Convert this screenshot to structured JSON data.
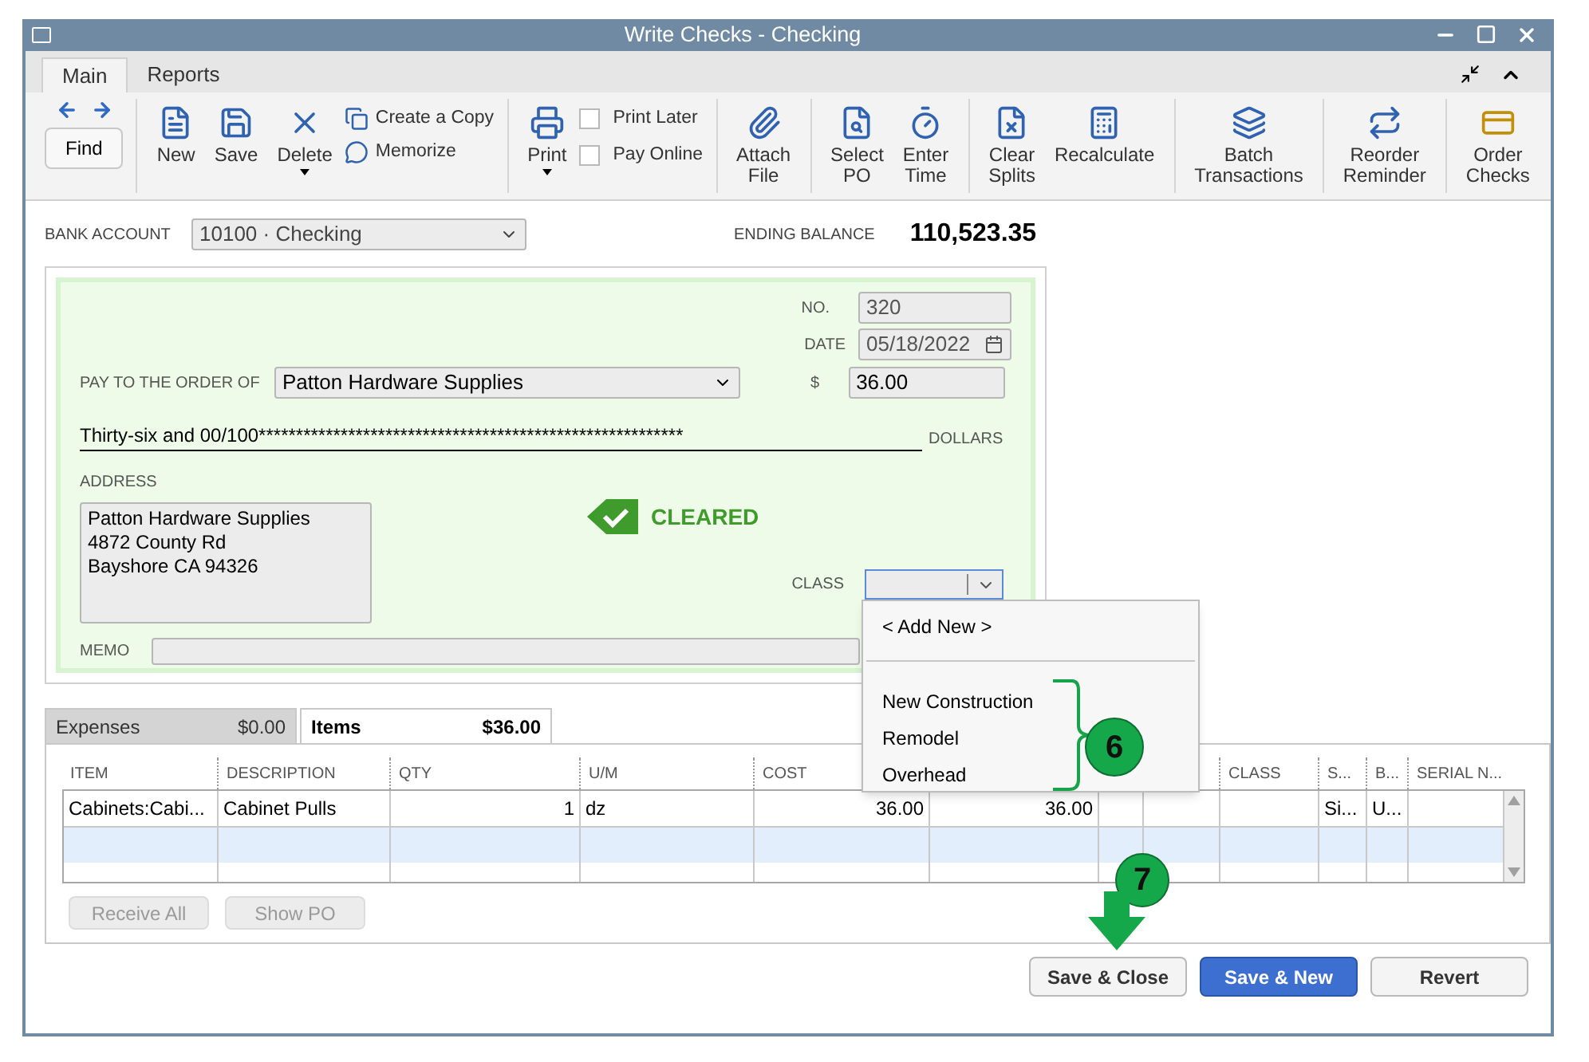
{
  "window": {
    "title": "Write Checks - Checking"
  },
  "ribbon_tabs": [
    {
      "label": "Main",
      "selected": true
    },
    {
      "label": "Reports",
      "selected": false
    }
  ],
  "toolbar": [
    [
      {
        "kind": "nav",
        "label": "Find"
      }
    ],
    [
      {
        "kind": "large",
        "label": "New",
        "has_menu": false
      },
      {
        "kind": "large",
        "label": "Save",
        "has_menu": false
      },
      {
        "kind": "large",
        "label": "Delete",
        "has_menu": true
      },
      {
        "kind": "small",
        "labels": [
          "Create a Copy",
          "Memorize"
        ]
      }
    ],
    [
      {
        "kind": "large",
        "label": "Print",
        "has_menu": true
      },
      {
        "kind": "check",
        "options": [
          {
            "label": "Print Later",
            "checked": false
          },
          {
            "label": "Pay Online",
            "checked": false
          }
        ]
      }
    ],
    [
      {
        "kind": "large",
        "label": "Attach File",
        "has_menu": false
      }
    ],
    [
      {
        "kind": "large",
        "label": "Select PO",
        "has_menu": false
      },
      {
        "kind": "large",
        "label": "Enter Time",
        "has_menu": false
      }
    ],
    [
      {
        "kind": "large",
        "label": "Clear Splits",
        "has_menu": false
      },
      {
        "kind": "large",
        "label": "Recalculate",
        "has_menu": false
      }
    ],
    [
      {
        "kind": "large",
        "label": "Batch Transactions",
        "has_menu": false
      }
    ],
    [
      {
        "kind": "large",
        "label": "Reorder Reminder",
        "has_menu": false
      }
    ],
    [
      {
        "kind": "large",
        "label": "Order Checks",
        "has_menu": false
      }
    ]
  ],
  "bank_account": {
    "label": "BANK ACCOUNT",
    "value": "10100 · Checking"
  },
  "ending_balance": {
    "label": "ENDING BALANCE",
    "value": "110,523.35"
  },
  "check": {
    "no_label": "NO.",
    "no": "320",
    "date_label": "DATE",
    "date": "05/18/2022",
    "payee_label": "PAY TO THE ORDER OF",
    "payee": "Patton Hardware Supplies",
    "amount_label": "$",
    "amount": "36.00",
    "amount_words": "Thirty-six and 00/100*********************************************************",
    "dollars_label": "DOLLARS",
    "address_label": "ADDRESS",
    "address": [
      "Patton Hardware Supplies",
      "4872 County Rd",
      "Bayshore CA 94326"
    ],
    "status": "CLEARED",
    "class_label": "CLASS",
    "memo_label": "MEMO"
  },
  "class_dropdown": {
    "add_new": "< Add New >",
    "items": [
      {
        "label": "New Construction",
        "selected": false
      },
      {
        "label": "Remodel",
        "selected": false
      },
      {
        "label": "Overhead",
        "selected": false
      }
    ]
  },
  "detail_tabs": [
    {
      "label": "Expenses",
      "amount": "$0.00",
      "selected": false
    },
    {
      "label": "Items",
      "amount": "$36.00",
      "selected": true
    }
  ],
  "table": {
    "columns": [
      "ITEM",
      "DESCRIPTION",
      "QTY",
      "U/M",
      "COST",
      null,
      null,
      null,
      "CLASS",
      "S...",
      "B...",
      "SERIAL N..."
    ],
    "rows": [
      [
        "Cabinets:Cabi...",
        "Cabinet Pulls",
        "1",
        "dz",
        "36.00",
        "36.00",
        "",
        "",
        "",
        "Si...",
        "U...",
        ""
      ]
    ]
  },
  "table_buttons": [
    {
      "label": "Receive All",
      "disabled": true
    },
    {
      "label": "Show PO",
      "disabled": true
    }
  ],
  "footer_buttons": [
    {
      "label": "Save & Close",
      "primary": false
    },
    {
      "label": "Save & New",
      "primary": true
    },
    {
      "label": "Revert",
      "primary": false
    }
  ],
  "callouts": [
    "6",
    "7"
  ]
}
